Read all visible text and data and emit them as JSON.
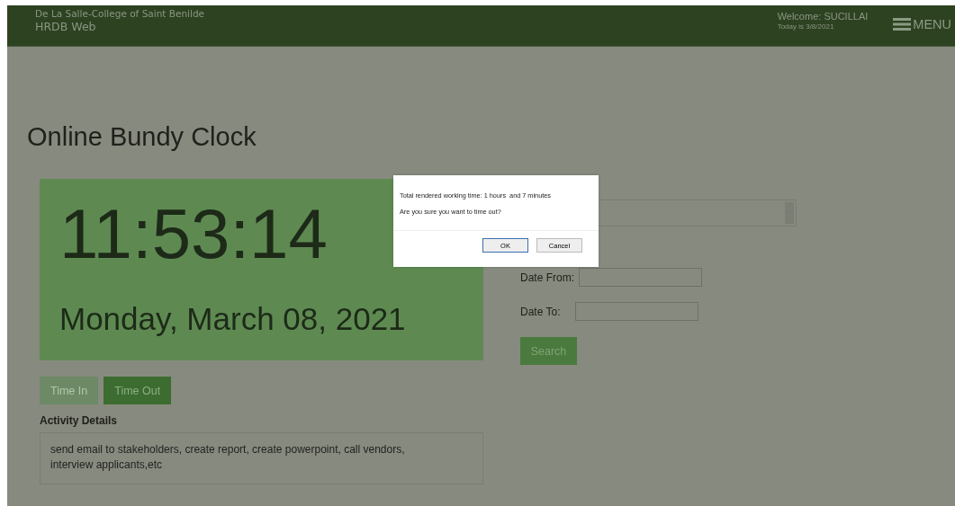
{
  "header": {
    "org": "De La Salle-College of Saint Benilde",
    "app": "HRDB Web",
    "welcome": "Welcome: SUCILLAI",
    "today": "Today is 3/8/2021",
    "menu": "MENU"
  },
  "page_title": "Online Bundy Clock",
  "clock": {
    "time": "11:53:14",
    "date": "Monday, March 08, 2021"
  },
  "actions": [
    {
      "label": "Time In",
      "disabled": true
    },
    {
      "label": "Time Out",
      "disabled": false
    }
  ],
  "activity": {
    "label": "Activity Details",
    "value": "send email to stakeholders, create report, create powerpoint, call vendors, interview applicants,etc"
  },
  "filter": {
    "date_from_label": "Date From:",
    "date_to_label": "Date To:",
    "search": "Search"
  },
  "dialog": {
    "lines": [
      "Total rendered working time: 1 hours  and 7 minutes",
      "Are you sure you want to time out?"
    ],
    "buttons": [
      {
        "label": "OK",
        "selected": true
      },
      {
        "label": "Cancel",
        "selected": false
      }
    ]
  }
}
